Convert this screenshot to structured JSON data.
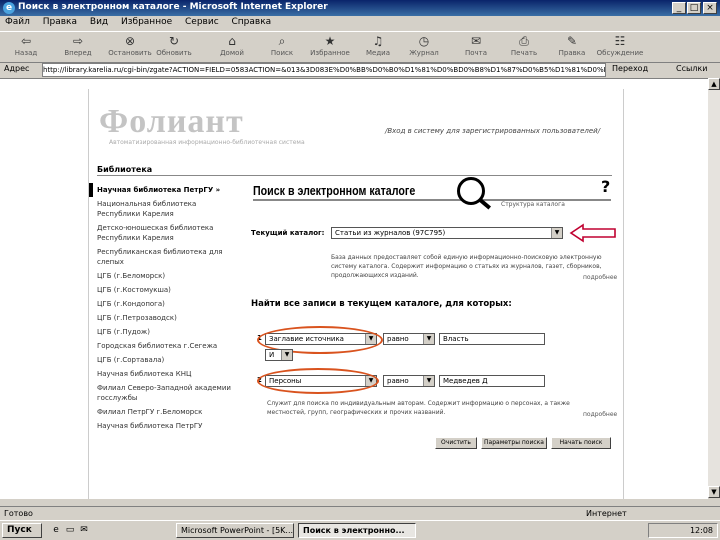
{
  "window": {
    "title": "Поиск в электронном каталоге - Microsoft Internet Explorer",
    "ie_icon": "e",
    "minimize": "_",
    "maximize": "□",
    "close": "×"
  },
  "menu": [
    "Файл",
    "Правка",
    "Вид",
    "Избранное",
    "Сервис",
    "Справка"
  ],
  "toolbar": {
    "back": "Назад",
    "forward": "Вперед",
    "stop": "Остановить",
    "refresh": "Обновить",
    "home": "Домой",
    "search": "Поиск",
    "favorites": "Избранное",
    "media": "Медиа",
    "history": "Журнал",
    "mail": "Почта",
    "print": "Печать",
    "edit": "Правка",
    "discuss": "Обсуждение"
  },
  "address": {
    "label": "Адрес",
    "url": "http://library.karelia.ru/cgi-bin/zgate?ACTION=FIELD=0583ACTION=&013&3D083E%D0%BB%D0%B0%D1%81%D0%BD0%B8%D1%87%D0%B5%D1%81%D0%BA%D0%B8%D0%B5%D0%B0%D0%B7%D0%B0%D0%BF%D0%B8%D1%81%D0%B8%D0%B8",
    "go": "Переход",
    "links": "Ссылки"
  },
  "page": {
    "logo": "Фолиант",
    "logo_sub": "Автоматизированная информационно-библиотечная система",
    "login_link": "/Вход в систему для зарегистрированных пользователей/",
    "libraries_heading": "Библиотека",
    "libraries": [
      "Научная библиотека ПетрГУ »",
      "Национальная библиотека Республики Карелия",
      "Детско-юношеская библиотека Республики Карелия",
      "Республиканская библиотека для слепых",
      "ЦГБ (г.Беломорск)",
      "ЦГБ (г.Костомукша)",
      "ЦГБ (г.Кондопога)",
      "ЦГБ (г.Петрозаводск)",
      "ЦГБ (г.Пудож)",
      "Городская библиотека г.Сегежа",
      "ЦГБ (г.Сортавала)",
      "Научная библиотека КНЦ",
      "Филиал Северо-Западной академии госслужбы",
      "Филиал ПетрГУ г.Беломорск",
      "Научная библиотека ПетрГУ"
    ],
    "main_title": "Поиск в электронном каталоге",
    "help": "?",
    "advanced_link": "Структура каталога",
    "current_catalog_label": "Текущий каталог:",
    "current_catalog_value": "Статьи из журналов (97С795)",
    "catalog_desc": "База данных предоставляет собой единую информационно-поисковую электронную систему каталога. Содержит информацию о статьях из журналов, газет, сборников, продолжающихся изданий.",
    "more": "подробнее",
    "find_label": "Найти все записи в текущем каталоге, для которых:",
    "row1": {
      "marker": "1",
      "field": "Заглавие источника",
      "relation": "равно",
      "value": "Власть"
    },
    "row_bool": "И",
    "row2": {
      "marker": "2",
      "field": "Персоны",
      "relation": "равно",
      "value": "Медведев Д"
    },
    "row2_desc": "Служит для поиска по индивидуальным авторам. Содержит информацию о персонах, а также местностей, групп, географических и прочих названий.",
    "more2": "подробнее",
    "buttons": {
      "clear": "Очистить",
      "search_params": "Параметры поиска",
      "new_query": "Начать поиск"
    }
  },
  "status": {
    "text": "Готово",
    "zone": "Интернет"
  },
  "taskbar": {
    "start": "Пуск",
    "tasks": [
      "Microsoft PowerPoint - [5K...",
      "Поиск в электронно..."
    ],
    "clock": "12:08"
  },
  "colors": {
    "highlight_oval": "#d9531e",
    "arrow": "#c00030"
  }
}
